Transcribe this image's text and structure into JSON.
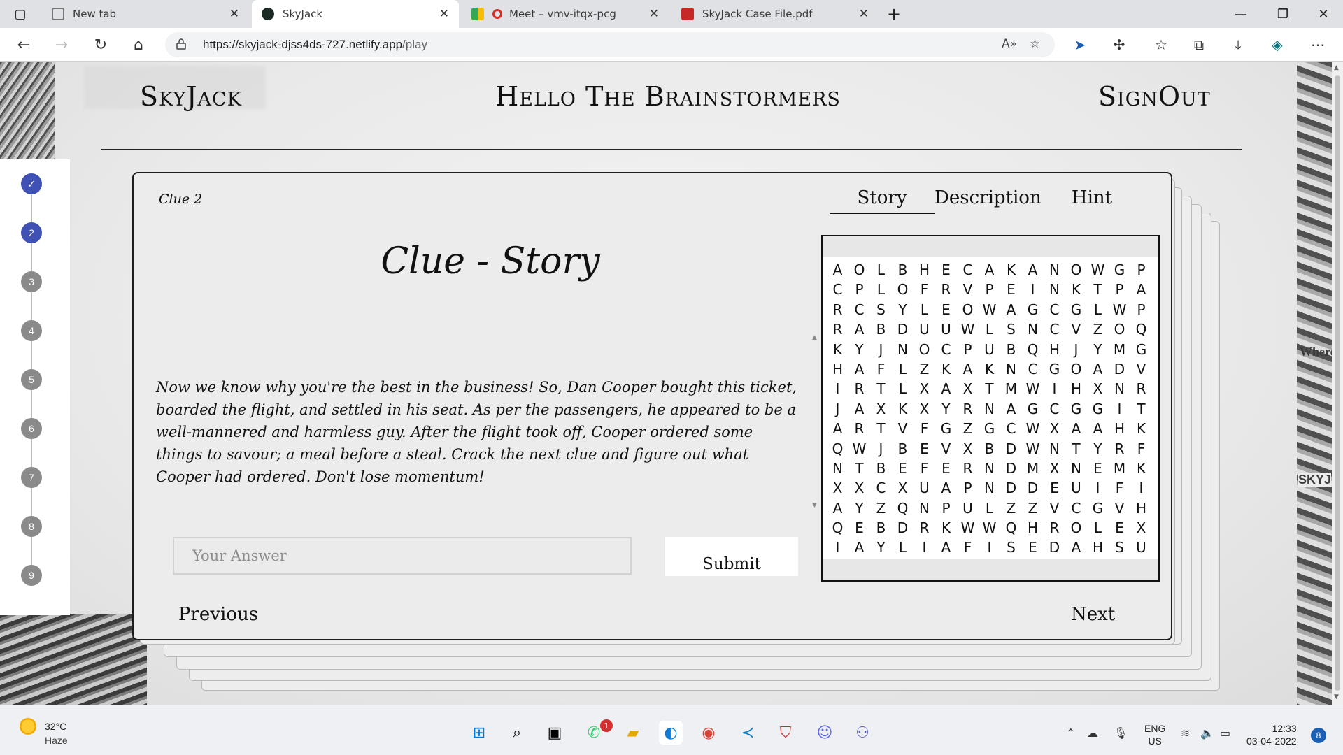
{
  "browser": {
    "tabs": [
      {
        "title": "New tab",
        "active": false
      },
      {
        "title": "SkyJack",
        "active": true
      },
      {
        "title": "Meet – vmv-itqx-pcg",
        "active": false
      },
      {
        "title": "SkyJack Case File.pdf",
        "active": false
      }
    ],
    "url_host": "https://skyjack-djss4ds-727.netlify.app",
    "url_path": "/play"
  },
  "header": {
    "logo": "SkyJack",
    "greeting": "Hello The Brainstormers",
    "signout": "SignOut"
  },
  "stepper": {
    "steps": [
      "✓",
      "2",
      "3",
      "4",
      "5",
      "6",
      "7",
      "8",
      "9"
    ],
    "completed": 1,
    "current": 2
  },
  "clue": {
    "number_label": "Clue 2",
    "title": "Clue - Story",
    "story": "Now we know why you're the best in the business! So, Dan Cooper bought this ticket, boarded the flight, and settled in his seat. As per the passengers, he appeared to be a well-mannered and harmless guy. After the flight took off, Cooper ordered some things to savour; a meal before a steal. Crack the next clue and figure out what Cooper had ordered. Don't lose momentum!",
    "tabs": [
      "Story",
      "Description",
      "Hint"
    ],
    "active_tab": "Story",
    "answer_placeholder": "Your Answer",
    "answer_value": "",
    "submit_label": "Submit",
    "previous_label": "Previous",
    "next_label": "Next"
  },
  "puzzle": {
    "rows": [
      "AOLBHECAKANOWGP",
      "CPLOFRVPEINKTPA",
      "RCSYLEOWAGCGLWP",
      "RABDUUWLSNCVZOQ",
      "KYJNOCPUBQHJYMG",
      "HAFLZKAKNCGOADV",
      "IRTLXAXTMWIHXNR",
      "JAXKXYRNAGCGGIT",
      "ARTVFGZGCWXAAHK",
      "QWJBEVXBDWNTYRF",
      "NTBEFERNDMXNEMK",
      "XXCXUAPNDDEUIFI",
      "AYZQNPULZZVCGVH",
      "QEBDRKWWQHROLEX",
      "IAYLIAFISEDAHSU"
    ]
  },
  "taskbar": {
    "temperature": "32°C",
    "weather": "Haze",
    "whatsapp_badge": "1",
    "lang_line1": "ENG",
    "lang_line2": "US",
    "time": "12:33",
    "date": "03-04-2022",
    "notifications": "8"
  }
}
